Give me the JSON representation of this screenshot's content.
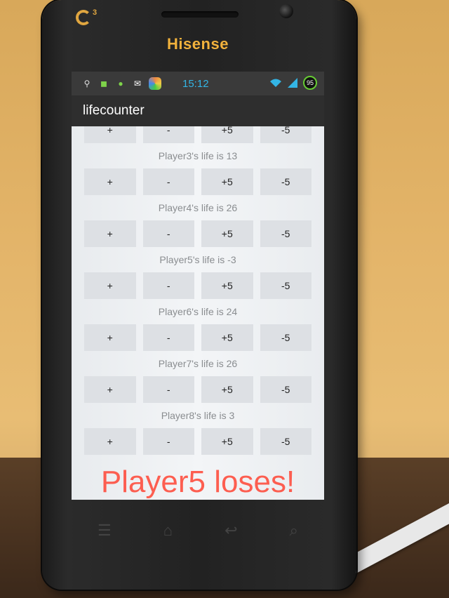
{
  "device": {
    "brand": "Hisense",
    "logo": "G",
    "logo_sup": "3"
  },
  "status": {
    "time": "15:12",
    "battery": "95"
  },
  "app": {
    "title": "lifecounter"
  },
  "buttons": {
    "plus": "+",
    "minus": "-",
    "plus5": "+5",
    "minus5": "-5"
  },
  "players": [
    {
      "label": "Player3's life is 13"
    },
    {
      "label": "Player4's life is 26"
    },
    {
      "label": "Player5's life is -3"
    },
    {
      "label": "Player6's life is 24"
    },
    {
      "label": "Player7's life is 26"
    },
    {
      "label": "Player8's life is 3"
    }
  ],
  "overlay": {
    "message": "Player5 loses!"
  }
}
